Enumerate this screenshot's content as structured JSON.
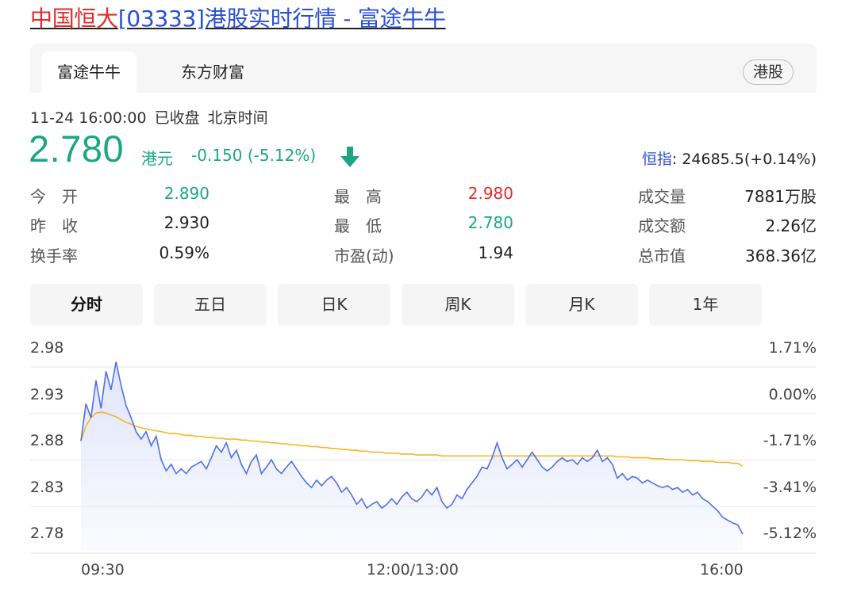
{
  "title": {
    "name": "中国恒大",
    "code_and_suffix": "[03333]港股实时行情 - 富途牛牛"
  },
  "tabs": [
    {
      "label": "富途牛牛",
      "active": true
    },
    {
      "label": "东方财富",
      "active": false
    }
  ],
  "market_badge": "港股",
  "status": {
    "datetime": "11-24 16:00:00",
    "state": "已收盘",
    "timezone": "北京时间"
  },
  "quote": {
    "price": "2.780",
    "currency": "港元",
    "change": "-0.150 (-5.12%)",
    "direction_icon": "down-arrow-icon"
  },
  "index": {
    "label": "恒指",
    "value": ": 24685.5(+0.14%)"
  },
  "stats": {
    "col1": [
      {
        "label": "今　开",
        "value": "2.890"
      },
      {
        "label": "昨　收",
        "value": "2.930"
      },
      {
        "label": "换手率",
        "value": "0.59%"
      }
    ],
    "col2": [
      {
        "label": "最　高",
        "value": "2.980"
      },
      {
        "label": "最　低",
        "value": "2.780"
      },
      {
        "label": "市盈(动)",
        "value": "1.94"
      }
    ],
    "col3": [
      {
        "label": "成交量",
        "value": "7881万股"
      },
      {
        "label": "成交额",
        "value": "2.26亿"
      },
      {
        "label": "总市值",
        "value": "368.36亿"
      }
    ]
  },
  "periods": [
    {
      "label": "分时",
      "active": true
    },
    {
      "label": "五日",
      "active": false
    },
    {
      "label": "日K",
      "active": false
    },
    {
      "label": "周K",
      "active": false
    },
    {
      "label": "月K",
      "active": false
    },
    {
      "label": "1年",
      "active": false
    }
  ],
  "intraday": {
    "y_labels": [
      "2.98",
      "2.93",
      "2.88",
      "2.83",
      "2.78"
    ],
    "pct_labels": [
      "1.71%",
      "0.00%",
      "-1.71%",
      "-3.41%",
      "-5.12%"
    ],
    "x_labels": [
      "09:30",
      "12:00/13:00",
      "16:00"
    ],
    "price_min": 2.78,
    "price_max": 2.98,
    "colors": {
      "price_line": "#4f6fe8",
      "avg_line": "#f2b824",
      "area_fill": "#dfe5fb",
      "grid": "#e6e6e6"
    },
    "price": [
      2.88,
      2.92,
      2.905,
      2.945,
      2.915,
      2.955,
      2.935,
      2.965,
      2.94,
      2.918,
      2.905,
      2.89,
      2.882,
      2.89,
      2.875,
      2.885,
      2.86,
      2.848,
      2.855,
      2.845,
      2.85,
      2.845,
      2.852,
      2.855,
      2.858,
      2.85,
      2.862,
      2.875,
      2.868,
      2.878,
      2.862,
      2.87,
      2.855,
      2.845,
      2.858,
      2.865,
      2.845,
      2.852,
      2.86,
      2.85,
      2.845,
      2.852,
      2.858,
      2.85,
      2.842,
      2.835,
      2.83,
      2.838,
      2.832,
      2.838,
      2.842,
      2.835,
      2.825,
      2.83,
      2.822,
      2.812,
      2.818,
      2.808,
      2.812,
      2.815,
      2.808,
      2.812,
      2.818,
      2.812,
      2.82,
      2.825,
      2.818,
      2.815,
      2.82,
      2.828,
      2.822,
      2.83,
      2.815,
      2.808,
      2.812,
      2.822,
      2.818,
      2.828,
      2.835,
      2.842,
      2.852,
      2.85,
      2.862,
      2.878,
      2.862,
      2.85,
      2.855,
      2.86,
      2.852,
      2.86,
      2.868,
      2.86,
      2.852,
      2.848,
      2.852,
      2.858,
      2.862,
      2.858,
      2.86,
      2.855,
      2.862,
      2.858,
      2.862,
      2.87,
      2.858,
      2.862,
      2.855,
      2.84,
      2.845,
      2.838,
      2.842,
      2.84,
      2.835,
      2.838,
      2.835,
      2.832,
      2.83,
      2.832,
      2.828,
      2.83,
      2.825,
      2.828,
      2.822,
      2.825,
      2.818,
      2.815,
      2.81,
      2.805,
      2.798,
      2.795,
      2.792,
      2.79,
      2.78
    ],
    "avg": [
      2.88,
      2.896,
      2.905,
      2.91,
      2.911,
      2.91,
      2.908,
      2.906,
      2.903,
      2.9,
      2.898,
      2.896,
      2.894,
      2.893,
      2.892,
      2.891,
      2.89,
      2.889,
      2.888,
      2.888,
      2.887,
      2.886,
      2.886,
      2.885,
      2.885,
      2.884,
      2.884,
      2.883,
      2.883,
      2.882,
      2.882,
      2.882,
      2.881,
      2.881,
      2.88,
      2.88,
      2.879,
      2.879,
      2.878,
      2.878,
      2.877,
      2.877,
      2.876,
      2.876,
      2.875,
      2.875,
      2.874,
      2.874,
      2.873,
      2.873,
      2.872,
      2.872,
      2.871,
      2.871,
      2.87,
      2.87,
      2.869,
      2.869,
      2.868,
      2.868,
      2.868,
      2.867,
      2.867,
      2.867,
      2.866,
      2.866,
      2.866,
      2.865,
      2.865,
      2.865,
      2.865,
      2.865,
      2.864,
      2.864,
      2.864,
      2.864,
      2.864,
      2.864,
      2.864,
      2.864,
      2.864,
      2.864,
      2.864,
      2.864,
      2.864,
      2.864,
      2.864,
      2.864,
      2.864,
      2.864,
      2.864,
      2.864,
      2.864,
      2.864,
      2.864,
      2.864,
      2.864,
      2.864,
      2.864,
      2.864,
      2.864,
      2.864,
      2.864,
      2.864,
      2.864,
      2.864,
      2.864,
      2.863,
      2.863,
      2.863,
      2.862,
      2.862,
      2.862,
      2.862,
      2.861,
      2.861,
      2.861,
      2.86,
      2.86,
      2.86,
      2.86,
      2.859,
      2.859,
      2.859,
      2.858,
      2.858,
      2.858,
      2.857,
      2.857,
      2.857,
      2.856,
      2.856,
      2.853
    ]
  }
}
